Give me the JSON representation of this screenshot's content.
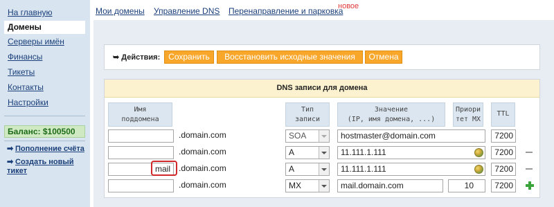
{
  "sidebar": {
    "items": [
      {
        "label": "На главную",
        "active": false
      },
      {
        "label": "Домены",
        "active": true
      },
      {
        "label": "Серверы имён",
        "active": false
      },
      {
        "label": "Финансы",
        "active": false
      },
      {
        "label": "Тикеты",
        "active": false
      },
      {
        "label": "Контакты",
        "active": false
      },
      {
        "label": "Настройки",
        "active": false
      }
    ],
    "balance": "Баланс:  $100500",
    "links": [
      {
        "arrow": "➡",
        "label": "Пополнение счёта"
      },
      {
        "arrow": "➡",
        "label": "Создать новый тикет"
      }
    ]
  },
  "tabs": [
    {
      "label": "Мои домены"
    },
    {
      "label": "Управление DNS"
    },
    {
      "label": "Перенаправление и парковка"
    }
  ],
  "new_badge": "новое",
  "actions": {
    "label": "Действия:",
    "save": "Сохранить",
    "restore": "Восстановить исходные значения",
    "cancel": "Отмена"
  },
  "dns": {
    "title": "DNS записи для домена",
    "columns": {
      "subdomain": "Имя\nподдомена",
      "type": "Тип\nзаписи",
      "value": "Значение\n(IP, имя домена, ...)",
      "priority": "Приори\nтет MX",
      "ttl": "TTL"
    },
    "domain_suffix": ".domain.com",
    "rows": [
      {
        "subdomain": "",
        "type": "SOA",
        "value": "hostmaster@domain.com",
        "priority": "",
        "ttl": "7200",
        "action": "none"
      },
      {
        "subdomain": "",
        "type": "A",
        "value": "11.111.1.111",
        "priority": "",
        "ttl": "7200",
        "action": "remove"
      },
      {
        "subdomain": "mail",
        "type": "A",
        "value": "11.111.1.111",
        "priority": "",
        "ttl": "7200",
        "action": "remove"
      },
      {
        "subdomain": "",
        "type": "MX",
        "value": "mail.domain.com",
        "priority": "10",
        "ttl": "7200",
        "action": "add"
      }
    ]
  },
  "colors": {
    "accent_orange": "#f9a72b",
    "sidebar_bg": "#d8e4ef",
    "balance_green": "#1e6b18",
    "highlight_red": "#d02828",
    "new_badge": "#e03a3a"
  }
}
